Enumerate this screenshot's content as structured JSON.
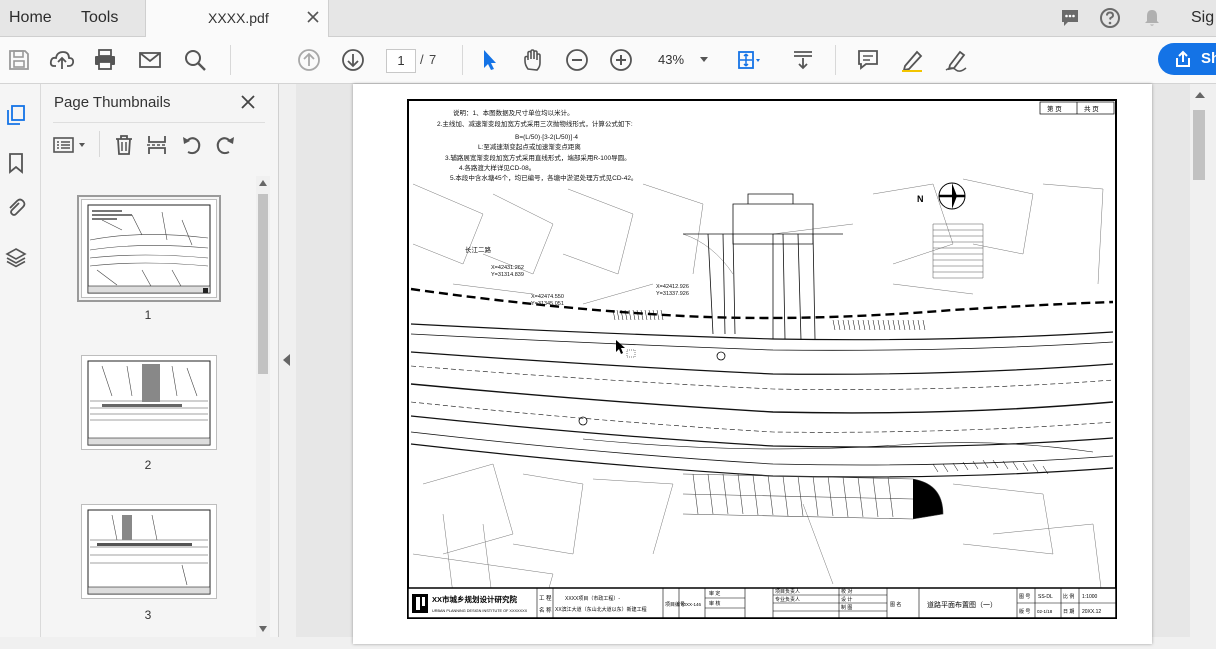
{
  "tabs": {
    "home": "Home",
    "tools": "Tools",
    "document": "XXXX.pdf"
  },
  "header": {
    "sign_in_partial": "Sig"
  },
  "toolbar": {
    "current_page": "1",
    "page_separator": "/",
    "total_pages": "7",
    "zoom": "43%",
    "share_partial": "Sh"
  },
  "panel": {
    "title": "Page Thumbnails",
    "thumbnails": [
      {
        "number": "1",
        "selected": true
      },
      {
        "number": "2",
        "selected": false
      },
      {
        "number": "3",
        "selected": false
      }
    ]
  },
  "drawing": {
    "notes": [
      "说明：1、本图数据及尺寸单位均以米计。",
      "2.主线加、减速渐变段加宽方式采用三次抛物线形式，计算公式如下:",
      "B=(L/50)·[3-2(L/50)]·4",
      "L:至减速渐变起点或加速渐变点距离",
      "3.辅路展宽渐变段加宽方式采用直线形式，端部采用R-100导圆。",
      "4.各路渡大样详见CD-08。",
      "5.本段中含水塘45个，均已编号，各塘中淤泥处理方式见CD-42。"
    ],
    "sheet_label": "第  页",
    "total_sheets_label": "共  页",
    "institute_name": "XX市城乡规划设计研究院",
    "institute_en": "URBAN PLANNING DESIGN INSTITUTE OF XXXXXXX",
    "project_label_1": "工 程",
    "project_label_2": "名 称",
    "project_name_1": "XXXX项目（市政工程）-",
    "project_name_2": "XX滨江大道（东山北大道以东）新建工程",
    "project_no_label": "项目编号",
    "project_no": "20XX-146",
    "approve": "审 定",
    "review": "审 核",
    "lead": "项目负责人",
    "specialist": "专业负责人",
    "checker": "校 对",
    "designer": "设 计",
    "drafter": "制 图",
    "drawing_title_label": "图 名",
    "drawing_title": "道路平面布置图（一）",
    "drawing_no_label": "图 号",
    "drawing_no": "SS-DL",
    "scale_label": "比 例",
    "scale": "1:1000",
    "version_label": "版 号",
    "version": "02-1/18",
    "date_label": "日 期",
    "date": "20XX.12",
    "road_label": "长江二路",
    "coord_1": "X=42431.262",
    "coord_2": "Y=31314.839",
    "coord_3": "X=42474.550",
    "coord_4": "Y=31345.051",
    "coord_5": "X=42412.926",
    "coord_6": "Y=31337.926",
    "north": "N"
  }
}
